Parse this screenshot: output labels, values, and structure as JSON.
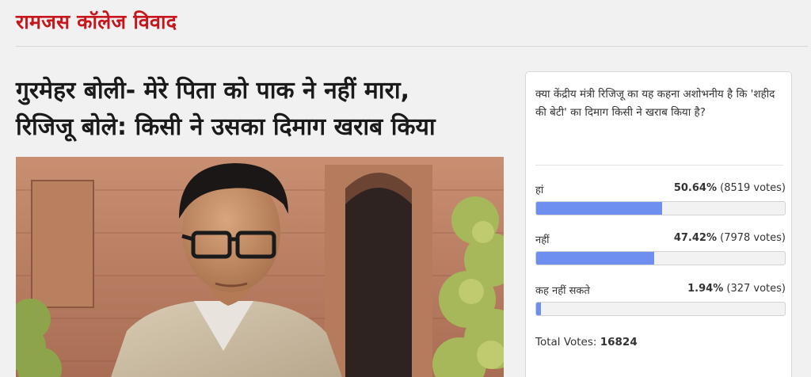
{
  "topic": {
    "title": "रामजस कॉलेज विवाद"
  },
  "article": {
    "headline_line1": "गुरमेहर बोली- मेरे पिता को पाक ने नहीं मारा,",
    "headline_line2": "रिजिजू बोले: किसी ने उसका दिमाग खराब किया"
  },
  "poll": {
    "question": "क्या केंद्रीय मंत्री रिजिजू का यह कहना अशोभनीय है कि 'शहीद की बेटी' का दिमाग किसी ने खराब किया है?",
    "options": [
      {
        "label": "हां",
        "percent": "50.64%",
        "votes": "(8519 votes)",
        "fraction": 0.5064
      },
      {
        "label": "नहीं",
        "percent": "47.42%",
        "votes": "(7978 votes)",
        "fraction": 0.4742
      },
      {
        "label": "कह नहीं सकते",
        "percent": "1.94%",
        "votes": "(327 votes)",
        "fraction": 0.0194
      }
    ],
    "total_label": "Total Votes:",
    "total_value": "16824",
    "bar_color": "#6e8ef0"
  }
}
